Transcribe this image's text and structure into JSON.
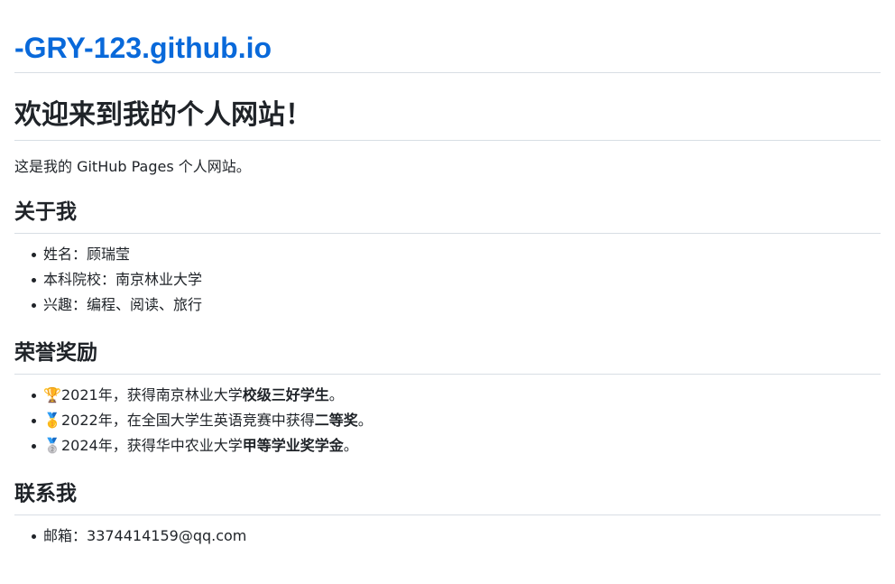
{
  "site": {
    "title": "-GRY-123.github.io"
  },
  "main": {
    "heading": "欢迎来到我的个人网站！",
    "intro": "这是我的 GitHub Pages 个人网站。"
  },
  "about": {
    "heading": "关于我",
    "items": [
      {
        "label": "姓名：",
        "value": "顾瑞莹"
      },
      {
        "label": "本科院校：",
        "value": "南京林业大学"
      },
      {
        "label": "兴趣：",
        "value": "编程、阅读、旅行"
      }
    ]
  },
  "honors": {
    "heading": "荣誉奖励",
    "items": [
      {
        "icon": "trophy-icon",
        "glyph": "🏆",
        "prefix": "2021年，获得南京林业大学",
        "bold": "校级三好学生",
        "suffix": "。"
      },
      {
        "icon": "gold-medal-icon",
        "glyph": "🥇",
        "prefix": "2022年，在全国大学生英语竞赛中获得",
        "bold": "二等奖",
        "suffix": "。"
      },
      {
        "icon": "silver-medal-icon",
        "glyph": "🥈",
        "prefix": "2024年，获得华中农业大学",
        "bold": "甲等学业奖学金",
        "suffix": "。"
      }
    ]
  },
  "contact": {
    "heading": "联系我",
    "items": [
      {
        "label": "邮箱：",
        "value": "3374414159@qq.com"
      }
    ]
  },
  "colors": {
    "link": "#0969da",
    "text": "#1f2328",
    "divider": "#d8dee4"
  }
}
